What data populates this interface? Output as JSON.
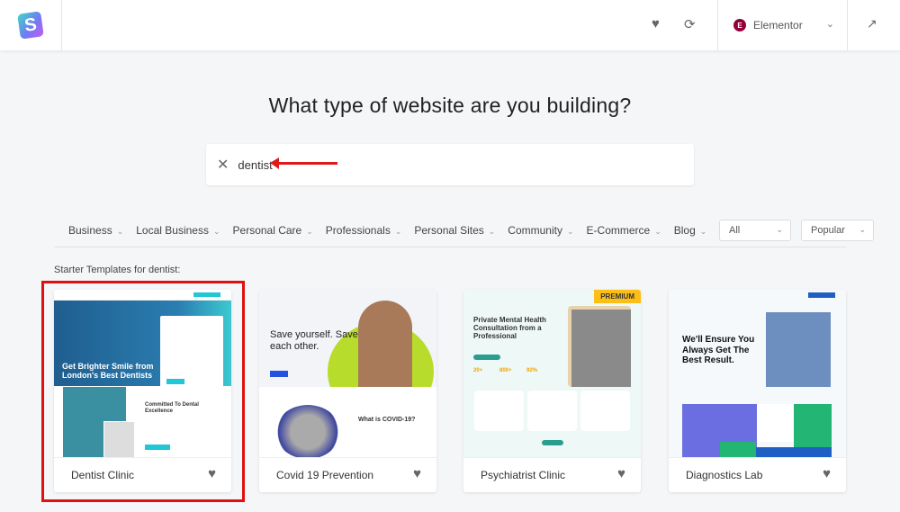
{
  "topbar": {
    "logo_letter": "S",
    "builder": "Elementor",
    "builder_icon_letter": "E",
    "icons": [
      "logo-icon",
      "heart-icon",
      "sync-icon",
      "chevron-down-icon",
      "external-link-icon"
    ]
  },
  "heading": "What type of website are you building?",
  "search": {
    "value": "dentist"
  },
  "filters": [
    "Business",
    "Local Business",
    "Personal Care",
    "Professionals",
    "Personal Sites",
    "Community",
    "E-Commerce",
    "Blog"
  ],
  "type_select": "All",
  "sort_select": "Popular",
  "results_label": "Starter Templates for dentist:",
  "colors": {
    "highlight": "#e01010",
    "premium": "#fbbf17",
    "elementor": "#92003b"
  },
  "templates": [
    {
      "name": "Dentist Clinic",
      "headline": "Get Brighter Smile from London's Best Dentists",
      "sub": "Committed To Dental Excellence",
      "highlighted": true
    },
    {
      "name": "Covid 19 Prevention",
      "headline": "Save yourself. Save each other.",
      "sub": "What is COVID-19?"
    },
    {
      "name": "Psychiatrist Clinic",
      "headline": "Private Mental Health Consultation from a Professional",
      "badge": "PREMIUM",
      "stats": [
        "20+",
        "800+",
        "92%"
      ]
    },
    {
      "name": "Diagnostics Lab",
      "headline": "We'll Ensure You Always Get The Best Result."
    }
  ]
}
